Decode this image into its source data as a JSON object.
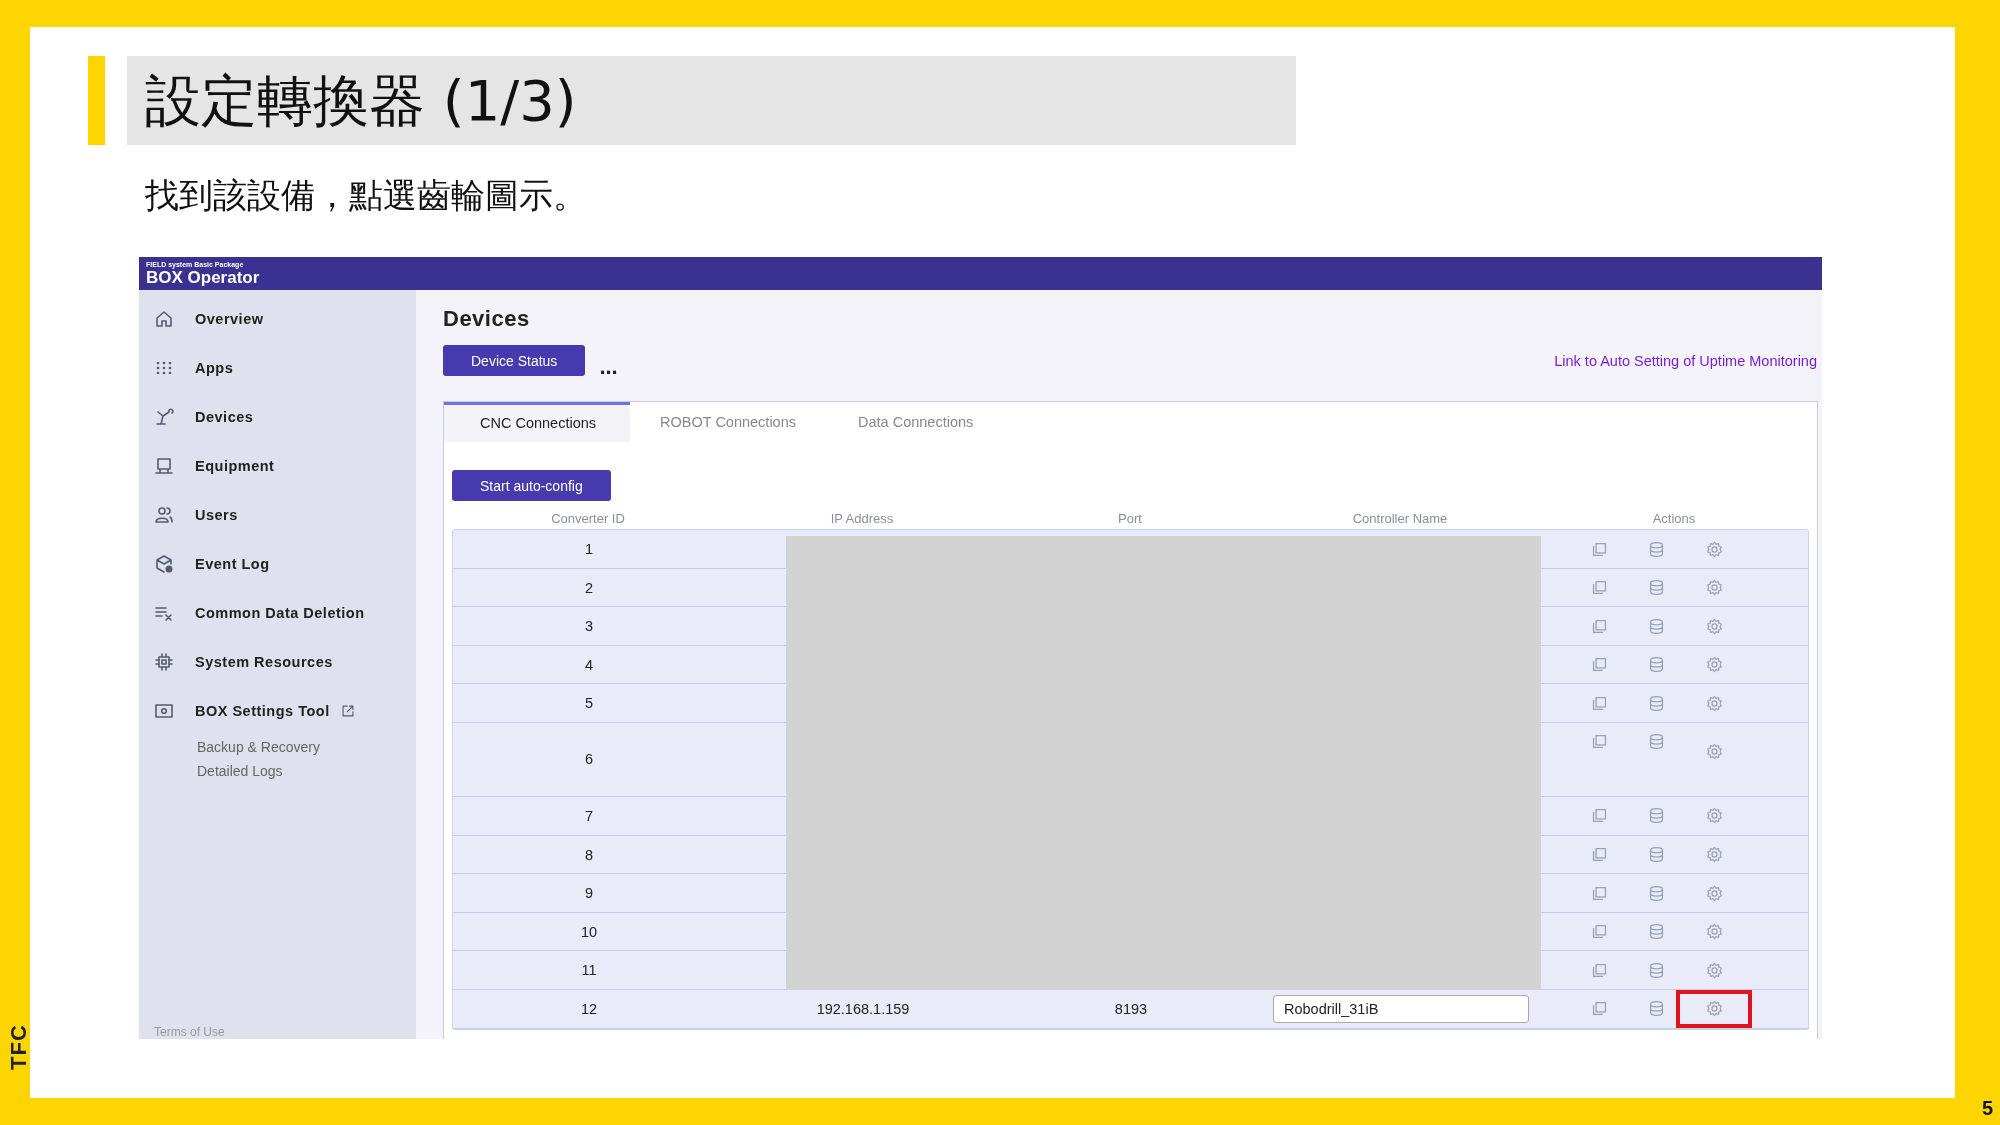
{
  "slide": {
    "title": "設定轉換器 (1/3)",
    "subtitle": "找到該設備，點選齒輪圖示。",
    "logo": "TFC",
    "page_number": "5"
  },
  "app": {
    "header": {
      "package": "FIELD system Basic Package",
      "product": "BOX Operator"
    },
    "sidebar": {
      "items": [
        {
          "label": "Overview",
          "external": false
        },
        {
          "label": "Apps",
          "external": false
        },
        {
          "label": "Devices",
          "external": false
        },
        {
          "label": "Equipment",
          "external": false
        },
        {
          "label": "Users",
          "external": false
        },
        {
          "label": "Event Log",
          "external": false
        },
        {
          "label": "Common Data Deletion",
          "external": false
        },
        {
          "label": "System Resources",
          "external": false
        },
        {
          "label": "BOX Settings Tool",
          "external": true,
          "children": [
            {
              "label": "Backup & Recovery"
            },
            {
              "label": "Detailed Logs"
            }
          ]
        }
      ],
      "footer": "Terms of Use"
    },
    "page_title": "Devices",
    "status_button": "Device Status",
    "more": "...",
    "link": "Link to Auto Setting of Uptime Monitoring",
    "tabs": [
      {
        "label": "CNC Connections",
        "selected": true
      },
      {
        "label": "ROBOT Connections",
        "selected": false
      },
      {
        "label": "Data Connections",
        "selected": false
      }
    ],
    "auto_config_button": "Start auto-config",
    "table": {
      "columns": [
        "Converter ID",
        "IP Address",
        "Port",
        "Controller Name",
        "Actions"
      ],
      "rows": [
        {
          "converter_id": "1",
          "redacted": true,
          "highlight": false
        },
        {
          "converter_id": "2",
          "redacted": true,
          "highlight": false
        },
        {
          "converter_id": "3",
          "redacted": true,
          "highlight": false
        },
        {
          "converter_id": "4",
          "redacted": true,
          "highlight": false
        },
        {
          "converter_id": "5",
          "redacted": true,
          "highlight": false
        },
        {
          "converter_id": "6",
          "redacted": true,
          "highlight": false
        },
        {
          "converter_id": "7",
          "redacted": true,
          "highlight": false
        },
        {
          "converter_id": "8",
          "redacted": true,
          "highlight": false
        },
        {
          "converter_id": "9",
          "redacted": true,
          "highlight": false
        },
        {
          "converter_id": "10",
          "redacted": true,
          "highlight": false
        },
        {
          "converter_id": "11",
          "redacted": true,
          "highlight": false
        },
        {
          "converter_id": "12",
          "redacted": false,
          "ip_address": "192.168.1.159",
          "port": "8193",
          "controller_name": "Robodrill_31iB",
          "highlight": true
        }
      ]
    }
  }
}
